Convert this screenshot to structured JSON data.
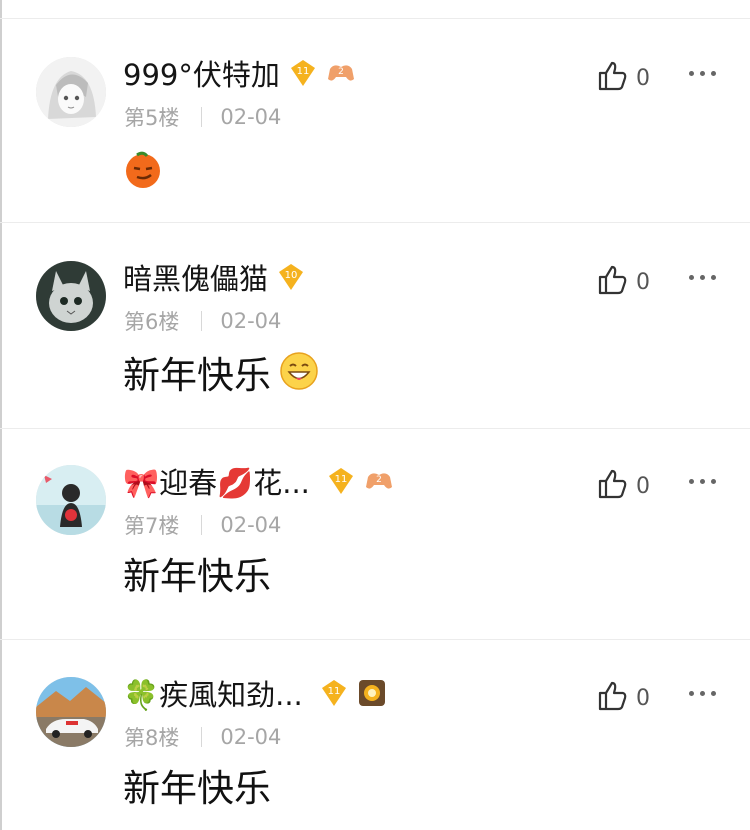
{
  "comments": [
    {
      "username": "999°伏特加",
      "level": "11",
      "extra_badge": "2",
      "floor": "第5楼",
      "date": "02-04",
      "content": "",
      "sticker": "orange-face-emoji",
      "likes": "0"
    },
    {
      "username": "暗黑傀儡猫",
      "level": "10",
      "floor": "第6楼",
      "date": "02-04",
      "content": "新年快乐",
      "emoji": "grin-emoji",
      "likes": "0"
    },
    {
      "username_prefix": "🎀",
      "username_mid": "迎春",
      "username_mid2": "💋",
      "username_suffix": "花...",
      "level": "11",
      "extra_badge": "2",
      "floor": "第7楼",
      "date": "02-04",
      "content": "新年快乐",
      "likes": "0"
    },
    {
      "username_prefix": "🍀",
      "username_suffix": "疾風知劲...",
      "level": "11",
      "floor": "第8楼",
      "date": "02-04",
      "content": "新年快乐",
      "likes": "0"
    }
  ],
  "colors": {
    "gold": "#f5b21e",
    "meta_gray": "#a6a6a6",
    "divider": "#ececec"
  }
}
